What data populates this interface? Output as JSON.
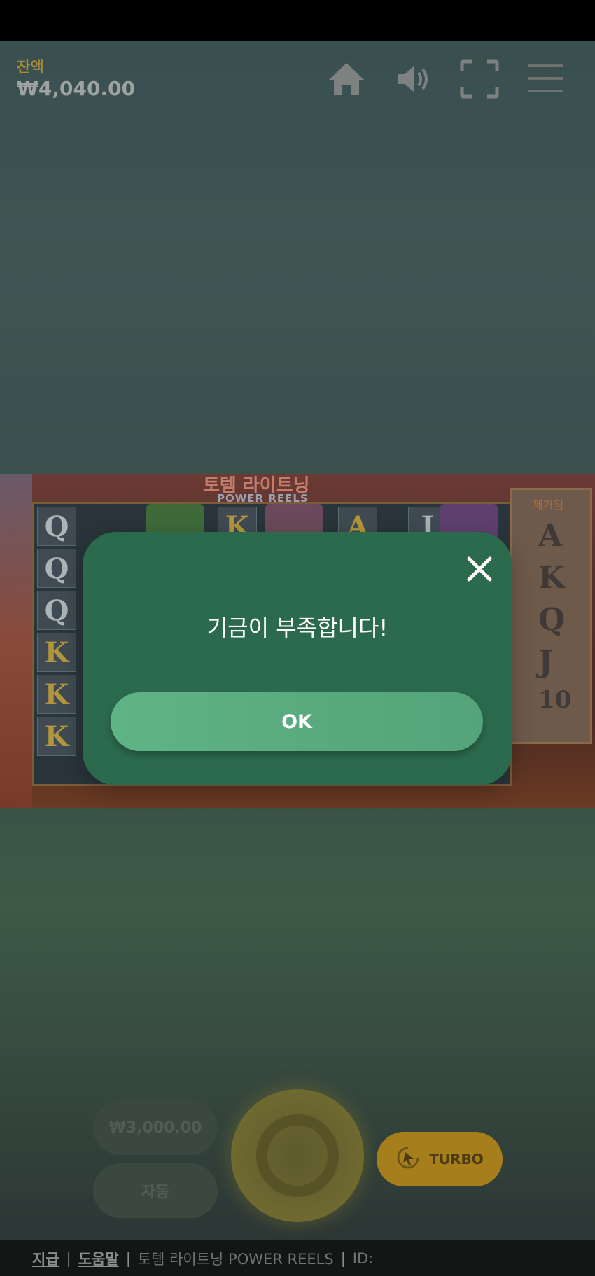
{
  "header": {
    "balance_label": "잔액",
    "balance_value": "₩4,040.00",
    "icons": [
      "home-icon",
      "volume-icon",
      "fullscreen-icon",
      "menu-icon"
    ]
  },
  "game": {
    "title": "토템 라이트닝",
    "subtitle": "POWER REELS",
    "side_label": "제거됨",
    "reel_symbols": [
      [
        "Q",
        "Q",
        "Q",
        "K",
        "K",
        "K"
      ],
      [
        "J",
        "",
        ""
      ],
      [
        "",
        ""
      ],
      [
        "K",
        ""
      ],
      [
        "",
        ""
      ],
      [
        "A",
        ""
      ],
      [
        "J",
        ""
      ]
    ],
    "side_symbols": [
      "A",
      "K",
      "Q",
      "J",
      "10"
    ]
  },
  "controls": {
    "bet_value": "₩3,000.00",
    "auto_label": "자동",
    "turbo_label": "TURBO"
  },
  "footer": {
    "pay_link": "지급",
    "help_link": "도움말",
    "game_name": "토템 라이트닝 POWER REELS",
    "id_label": "ID:"
  },
  "modal": {
    "message": "기금이 부족합니다!",
    "ok_label": "OK"
  },
  "colors": {
    "modal_bg": "#2c6a4d",
    "ok_button": "#5fb487",
    "balance_label": "#a88a3c",
    "turbo": "#a67e1b"
  }
}
